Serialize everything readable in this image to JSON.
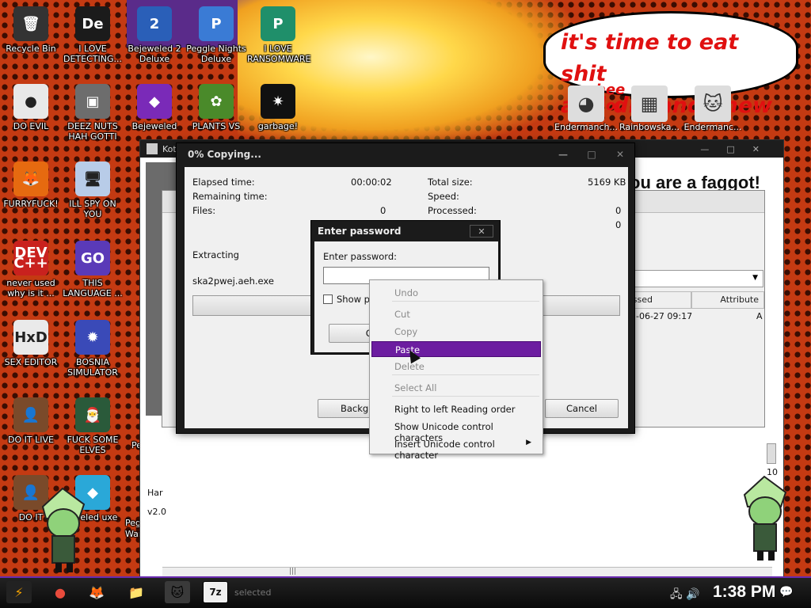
{
  "desktop": {
    "icons": [
      {
        "label": "Recycle Bin",
        "glyph": "🗑",
        "bg": "#333333"
      },
      {
        "label": "I LOVE DETECTING...",
        "glyph": "De",
        "bg": "#1b1b1b"
      },
      {
        "label": "Bejeweled 2 Deluxe",
        "glyph": "2",
        "bg": "#2a5fb8"
      },
      {
        "label": "Peggle Nights Deluxe",
        "glyph": "P",
        "bg": "#3a7bd5"
      },
      {
        "label": "I LOVE RANSOMWARE",
        "glyph": "P",
        "bg": "#1f8f6a"
      },
      {
        "label": "DO EVIL",
        "glyph": "●",
        "bg": "#e8e8e8"
      },
      {
        "label": "DEEZ NUTS HAH GOTTI",
        "glyph": "▣",
        "bg": "#6d6d6d"
      },
      {
        "label": "Bejeweled",
        "glyph": "◆",
        "bg": "#7a2ab8"
      },
      {
        "label": "PLANTS VS",
        "glyph": "✿",
        "bg": "#4a8a2a"
      },
      {
        "label": "garbage!",
        "glyph": "✷",
        "bg": "#111111"
      },
      {
        "label": "FURRYFUCK!",
        "glyph": "🦊",
        "bg": "#e66a10"
      },
      {
        "label": "ILL SPY ON YOU",
        "glyph": "🖥",
        "bg": "#b8cce8"
      },
      {
        "label": "never used why is it ...",
        "glyph": "DEV C++",
        "bg": "#c9211e"
      },
      {
        "label": "THIS LANGUAGE ...",
        "glyph": "GO",
        "bg": "#5a3ab8"
      },
      {
        "label": "SEX EDITOR",
        "glyph": "HxD",
        "bg": "#eaeaea"
      },
      {
        "label": "BOSNIA SIMULATOR",
        "glyph": "✹",
        "bg": "#3a4ab8"
      },
      {
        "label": "DO IT LIVE",
        "glyph": "👤",
        "bg": "#7a4a2a"
      },
      {
        "label": "FUCK SOME ELVES",
        "glyph": "🎅",
        "bg": "#2a5a3a"
      },
      {
        "label": "DO IT",
        "glyph": "👤",
        "bg": "#7a4a2a"
      },
      {
        "label": "eweled uxe",
        "glyph": "◆",
        "bg": "#2aa8d8"
      }
    ],
    "right_icons": [
      {
        "label": "Endermanch...",
        "glyph": "◕"
      },
      {
        "label": "Rainbowska...",
        "glyph": "▦"
      },
      {
        "label": "Endermanc...",
        "glyph": "🐱"
      }
    ],
    "bubble_text": "it's time to eat shit\nand die and chew",
    "bubble_overlay": "hee  an\nhou   d",
    "background_window_title": "Kot",
    "background_text": "ou are a faggot!",
    "bg_rows": [
      "Har",
      "v2.0",
      "10"
    ],
    "left_edge_labels": [
      "Pe",
      "Pegg",
      "Warcraft"
    ]
  },
  "manager": {
    "col_modified": "essed",
    "col_attributes": "Attribute",
    "row_date": "-06-27 09:17",
    "row_attr": "A",
    "status": "selected"
  },
  "copy_dialog": {
    "title": "0% Copying...",
    "elapsed_label": "Elapsed time:",
    "elapsed_value": "00:00:02",
    "remaining_label": "Remaining time:",
    "files_label": "Files:",
    "files_value": "0",
    "total_size_label": "Total size:",
    "total_size_value": "5169 KB",
    "speed_label": "Speed:",
    "processed_label": "Processed:",
    "processed_value": "0",
    "extra_value": "0",
    "extracting_label": "Extracting",
    "file_name": "ska2pwej.aeh.exe",
    "background_button": "Backgr",
    "cancel_button": "Cancel"
  },
  "password_dialog": {
    "title": "Enter password",
    "close": "✕",
    "prompt": "Enter password:",
    "value": "",
    "show_password": "Show pas",
    "ok_button": "OK"
  },
  "context_menu": {
    "items": [
      {
        "label": "Undo",
        "disabled": true
      },
      {
        "label": "Cut",
        "disabled": true
      },
      {
        "label": "Copy",
        "disabled": true
      },
      {
        "label": "Paste",
        "disabled": false,
        "highlighted": true
      },
      {
        "label": "Delete",
        "disabled": true
      },
      {
        "label": "Select All",
        "disabled": true
      },
      {
        "label": "Right to left Reading order",
        "disabled": false
      },
      {
        "label": "Show Unicode control characters",
        "disabled": false
      },
      {
        "label": "Insert Unicode control character",
        "disabled": false,
        "submenu": true
      }
    ]
  },
  "taskbar": {
    "start_glyph": "⚡",
    "chrome_glyph": "●",
    "firefox_glyph": "🦊",
    "explorer_glyph": "📁",
    "cat_glyph": "🐱",
    "zip_glyph": "7z",
    "clock": "1:38 PM",
    "tray_icons": "🖧 🔊",
    "notify_glyph": "💬"
  },
  "colors": {
    "accent": "#6c1da0",
    "bubble_text": "#e01010"
  }
}
